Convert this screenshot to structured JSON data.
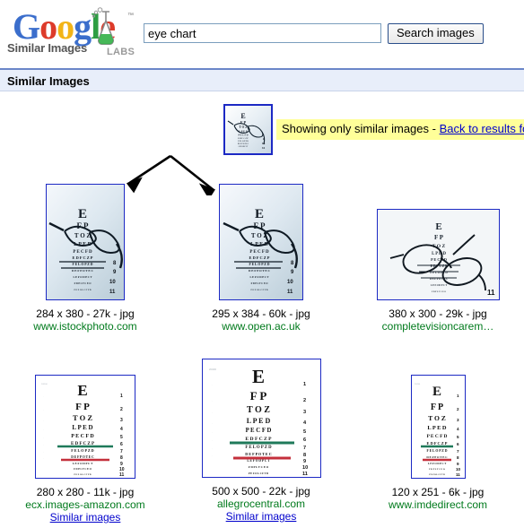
{
  "brand": {
    "wordmark": "Google",
    "wordmark_letters": [
      "G",
      "o",
      "o",
      "g",
      "l",
      "e"
    ],
    "trademark": "™",
    "sub_label": "Similar Images",
    "labs_label": "LABS",
    "flask_icon": "laboratory-flask-icon",
    "colors": {
      "blue": "#3b6ecc",
      "red": "#dd3b2a",
      "yellow": "#f2b417",
      "green": "#2e9e43",
      "link": "#0000cc",
      "site_green": "#007a1c",
      "notice_bg": "#ffff99",
      "section_bg": "#e8eefa",
      "thumb_border": "#1c29c4"
    }
  },
  "search": {
    "value": "eye chart",
    "placeholder": "",
    "button_label": "Search images"
  },
  "section": {
    "title": "Similar Images"
  },
  "notice": {
    "text": "Showing only similar images - ",
    "link_label": "Back to results fo",
    "seed_thumb_name": "eye-chart-with-glasses-thumbnail"
  },
  "arrows": {
    "name": "branching-arrows-graphic",
    "count": 2
  },
  "results": {
    "rows": [
      {
        "items": [
          {
            "image_name": "eye-chart-with-glasses-photo",
            "dimensions": "284 x 380 - 27k - jpg",
            "site": "www.istockphoto.com",
            "similar_label": null,
            "thumb_w": 86,
            "thumb_h": 128,
            "variant": "glasses-on-chart"
          },
          {
            "image_name": "eye-chart-with-glasses-photo",
            "dimensions": "295 x 384 - 60k - jpg",
            "site": "www.open.ac.uk",
            "similar_label": null,
            "thumb_w": 92,
            "thumb_h": 128,
            "variant": "glasses-on-chart"
          },
          {
            "image_name": "glasses-on-eye-chart-photo",
            "dimensions": "380 x 300 - 29k - jpg",
            "site": "completevisioncarem…",
            "similar_label": null,
            "thumb_w": 135,
            "thumb_h": 100,
            "variant": "glasses-closeup"
          }
        ]
      },
      {
        "items": [
          {
            "image_name": "snellen-eye-chart",
            "dimensions": "280 x 280 - 11k - jpg",
            "site": "ecx.images-amazon.com",
            "similar_label": "Similar images",
            "thumb_w": 110,
            "thumb_h": 114,
            "variant": "plain-chart"
          },
          {
            "image_name": "snellen-eye-chart",
            "dimensions": "500 x 500 - 22k - jpg",
            "site": "allegrocentral.com",
            "similar_label": "Similar images",
            "thumb_w": 131,
            "thumb_h": 131,
            "variant": "plain-chart"
          },
          {
            "image_name": "snellen-eye-chart",
            "dimensions": "120 x 251 - 6k - jpg",
            "site": "www.imdedirect.com",
            "similar_label": null,
            "thumb_w": 59,
            "thumb_h": 114,
            "variant": "plain-chart"
          }
        ]
      }
    ]
  },
  "chart_content": {
    "note": "Snellen eye chart depicted inside thumbnails",
    "lines": [
      "E",
      "F P",
      "T O Z",
      "L P E D",
      "P E C F D",
      "E D F C Z P",
      "F E L O P Z D",
      "D E F P O T E C",
      "L E F O D P C T",
      "F D P L T C E O",
      "P E Z O L C F T D"
    ],
    "line_numbers": [
      "1",
      "2",
      "3",
      "4",
      "5",
      "6",
      "7",
      "8",
      "9",
      "10",
      "11"
    ],
    "green_rule_after_line": 6,
    "red_rule_after_line": 8
  }
}
